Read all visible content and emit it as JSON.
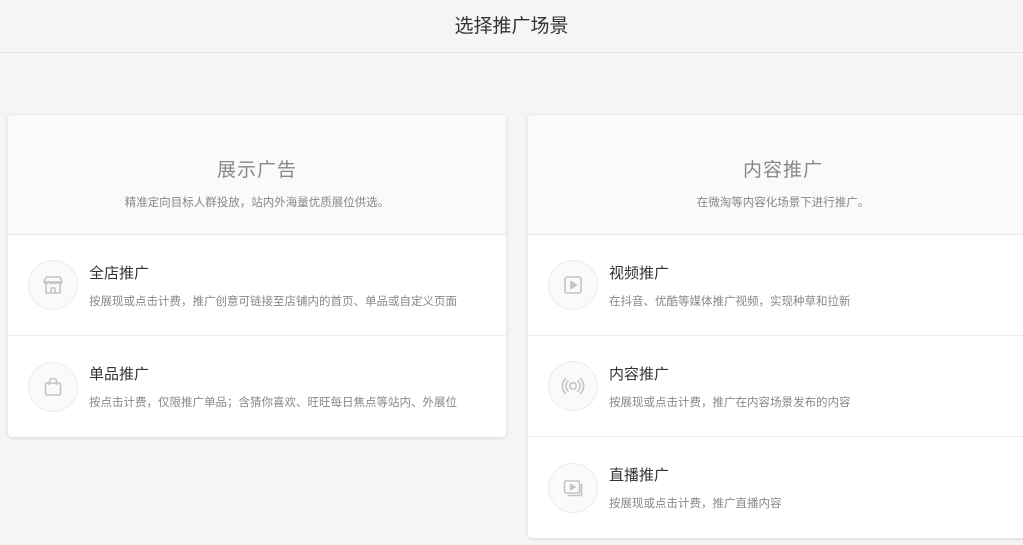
{
  "header": {
    "title": "选择推广场景"
  },
  "cards": [
    {
      "title": "展示广告",
      "subtitle": "精准定向目标人群投放，站内外海量优质展位供选。",
      "items": [
        {
          "icon": "store-icon",
          "title": "全店推广",
          "desc": "按展现或点击计费，推广创意可链接至店铺内的首页、单品或自定义页面"
        },
        {
          "icon": "bag-icon",
          "title": "单品推广",
          "desc": "按点击计费，仅限推广单品；含猜你喜欢、旺旺每日焦点等站内、外展位"
        }
      ]
    },
    {
      "title": "内容推广",
      "subtitle": "在微淘等内容化场景下进行推广。",
      "items": [
        {
          "icon": "video-play-icon",
          "title": "视频推广",
          "desc": "在抖音、优酷等媒体推广视频，实现种草和拉新"
        },
        {
          "icon": "broadcast-icon",
          "title": "内容推广",
          "desc": "按展现或点击计费，推广在内容场景发布的内容"
        },
        {
          "icon": "live-stream-icon",
          "title": "直播推广",
          "desc": "按展现或点击计费，推广直播内容"
        }
      ]
    }
  ],
  "colors": {
    "icon": "#c8c8c8",
    "background": "#f5f5f5"
  }
}
